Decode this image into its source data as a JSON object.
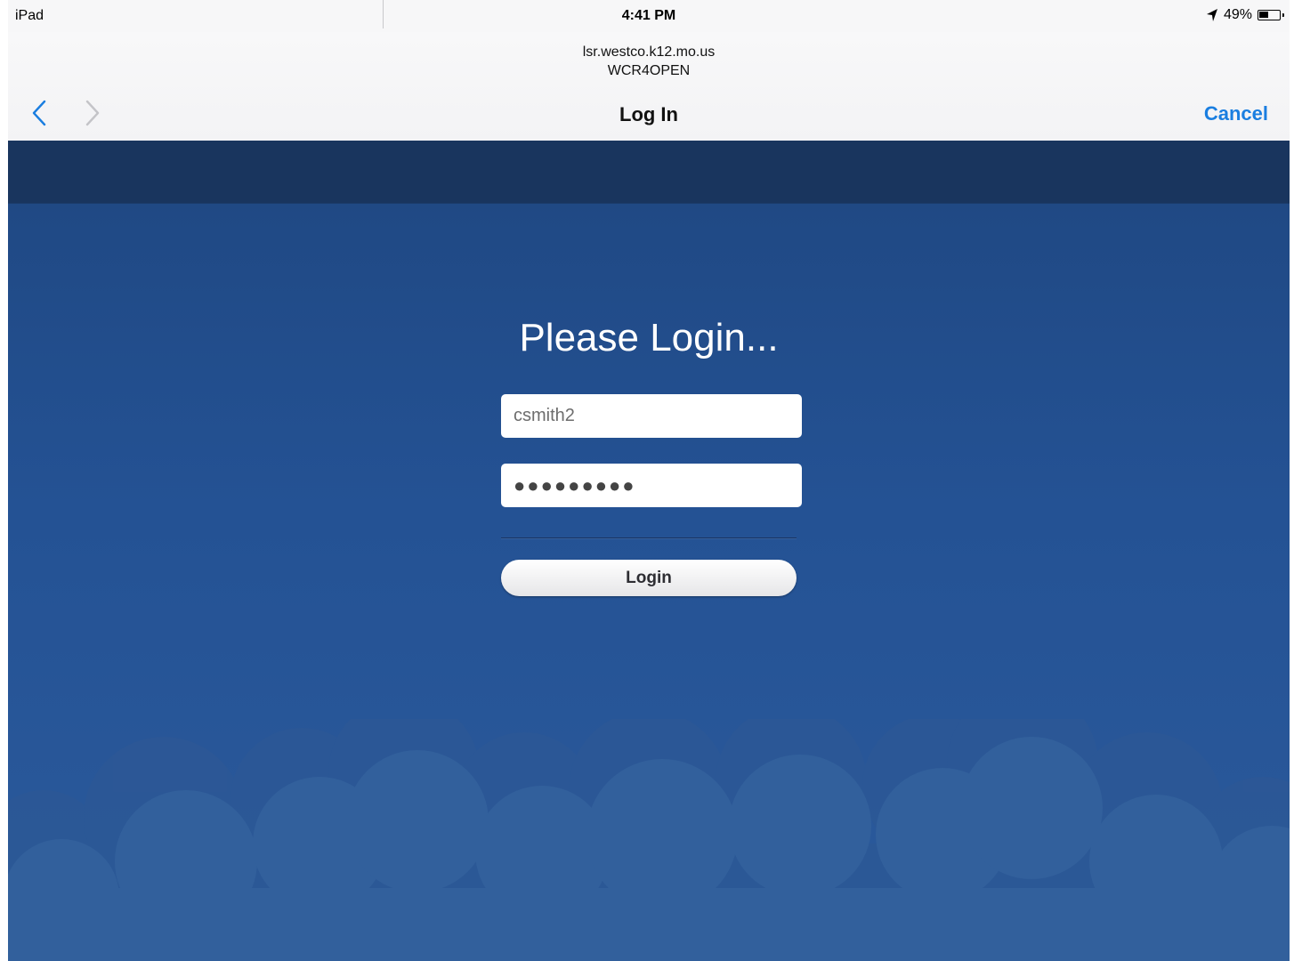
{
  "status_bar": {
    "device": "iPad",
    "time": "4:41 PM",
    "battery_percent": "49%",
    "battery_level": 0.49,
    "location_icon": "location-arrow-icon",
    "battery_icon": "battery-icon"
  },
  "header": {
    "host": "lsr.westco.k12.mo.us",
    "network": "WCR4OPEN",
    "title": "Log In",
    "cancel_label": "Cancel",
    "back_icon": "chevron-left-icon",
    "forward_icon": "chevron-right-icon",
    "accent_color": "#1a7ee0"
  },
  "login": {
    "title": "Please Login...",
    "username_value": "csmith2",
    "password_value": "●●●●●●●●●",
    "button_label": "Login"
  },
  "colors": {
    "background_top": "#1f4781",
    "background_bottom": "#2b5a9c",
    "band": "#19355e",
    "cloud": "#32609c"
  }
}
